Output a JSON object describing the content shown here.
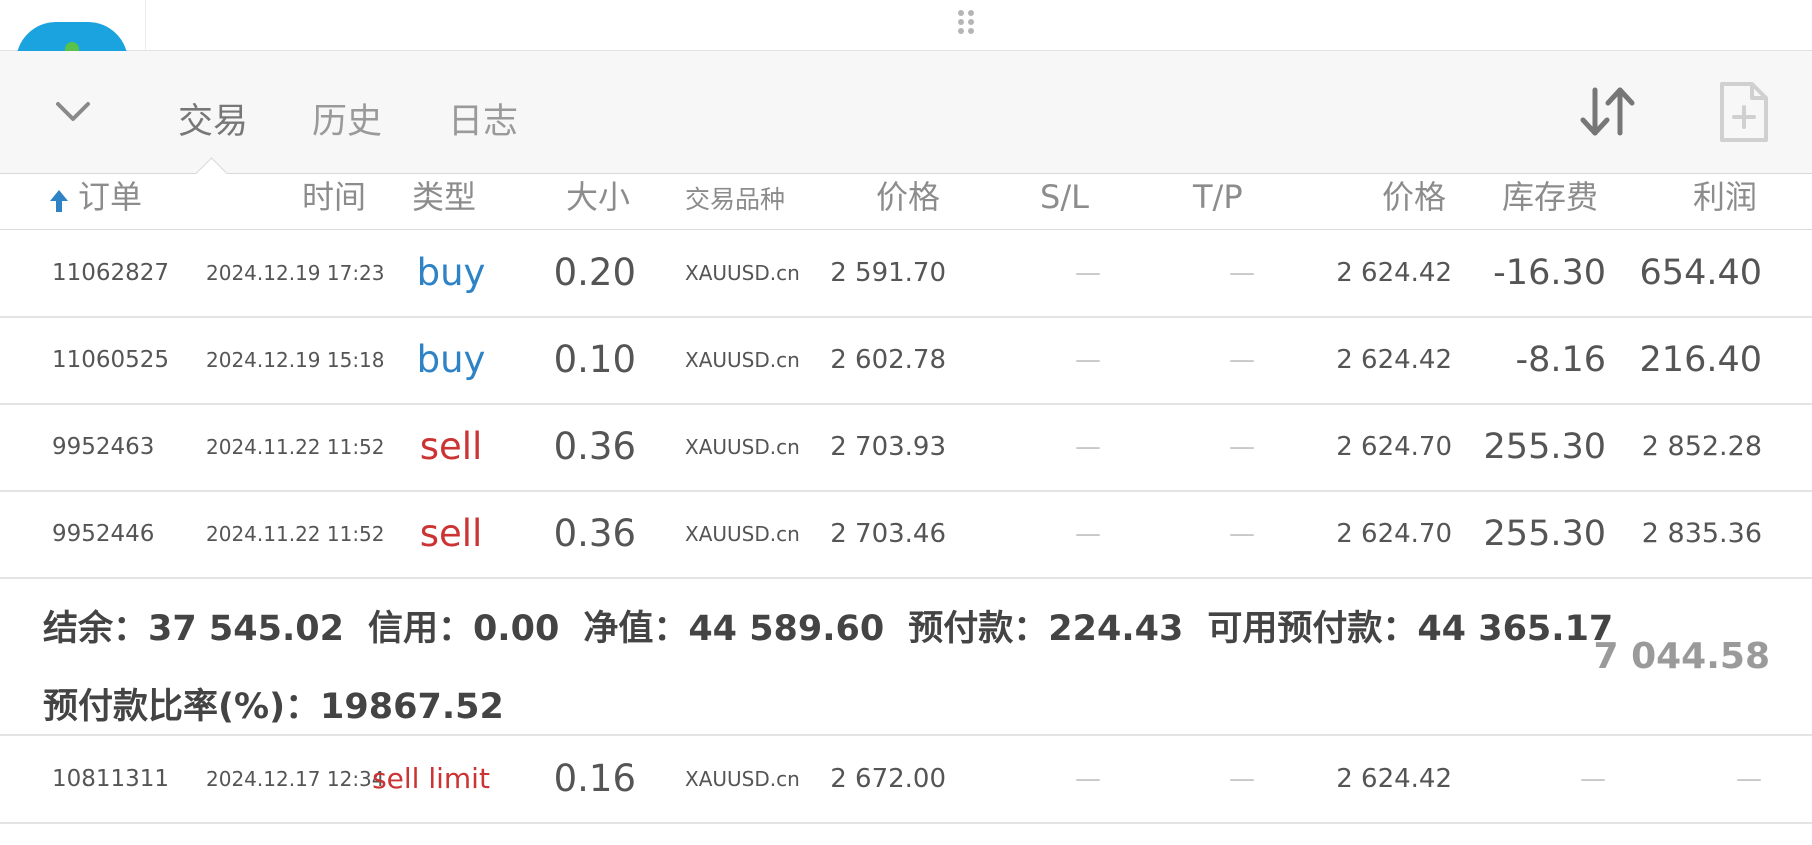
{
  "tabs": [
    {
      "label": "交易",
      "active": true
    },
    {
      "label": "历史",
      "active": false
    },
    {
      "label": "日志",
      "active": false
    }
  ],
  "icons": {
    "collapse": "chevron-down-icon",
    "sort": "sort-arrows-icon",
    "new_order": "new-document-icon",
    "column_sort": "arrow-up-icon",
    "drag": "drag-handle-icon"
  },
  "columns": {
    "order": "订单",
    "time": "时间",
    "type": "类型",
    "size": "大小",
    "symbol": "交易品种",
    "price": "价格",
    "sl": "S/L",
    "tp": "T/P",
    "current_price": "价格",
    "swap": "库存费",
    "profit": "利润"
  },
  "positions": [
    {
      "order": "11062827",
      "time": "2024.12.19 17:23",
      "type": "buy",
      "size": "0.20",
      "symbol": "XAUUSD.cn",
      "price": "2 591.70",
      "sl": "—",
      "tp": "—",
      "current_price": "2 624.42",
      "swap": "-16.30",
      "profit": "654.40"
    },
    {
      "order": "11060525",
      "time": "2024.12.19 15:18",
      "type": "buy",
      "size": "0.10",
      "symbol": "XAUUSD.cn",
      "price": "2 602.78",
      "sl": "—",
      "tp": "—",
      "current_price": "2 624.42",
      "swap": "-8.16",
      "profit": "216.40"
    },
    {
      "order": "9952463",
      "time": "2024.11.22 11:52",
      "type": "sell",
      "size": "0.36",
      "symbol": "XAUUSD.cn",
      "price": "2 703.93",
      "sl": "—",
      "tp": "—",
      "current_price": "2 624.70",
      "swap": "255.30",
      "profit": "2 852.28"
    },
    {
      "order": "9952446",
      "time": "2024.11.22 11:52",
      "type": "sell",
      "size": "0.36",
      "symbol": "XAUUSD.cn",
      "price": "2 703.46",
      "sl": "—",
      "tp": "—",
      "current_price": "2 624.70",
      "swap": "255.30",
      "profit": "2 835.36"
    }
  ],
  "summary": {
    "balance": "结余：37 545.02",
    "credit": "信用：0.00",
    "equity": "净值：44 589.60",
    "margin": "预付款：224.43",
    "free_margin": "可用预付款：44 365.17",
    "margin_level": "预付款比率(%)：19867.52",
    "total_profit": "7 044.58"
  },
  "pending_orders": [
    {
      "order": "10811311",
      "time": "2024.12.17 12:34",
      "type": "sell limit",
      "size": "0.16",
      "symbol": "XAUUSD.cn",
      "price": "2 672.00",
      "sl": "—",
      "tp": "—",
      "current_price": "2 624.42",
      "swap": "—",
      "profit": "—"
    }
  ],
  "colors": {
    "buy": "#2d83c6",
    "sell": "#cc3333",
    "toolbar_bg": "#f7f7f7",
    "logo": "#1ba3e0"
  }
}
